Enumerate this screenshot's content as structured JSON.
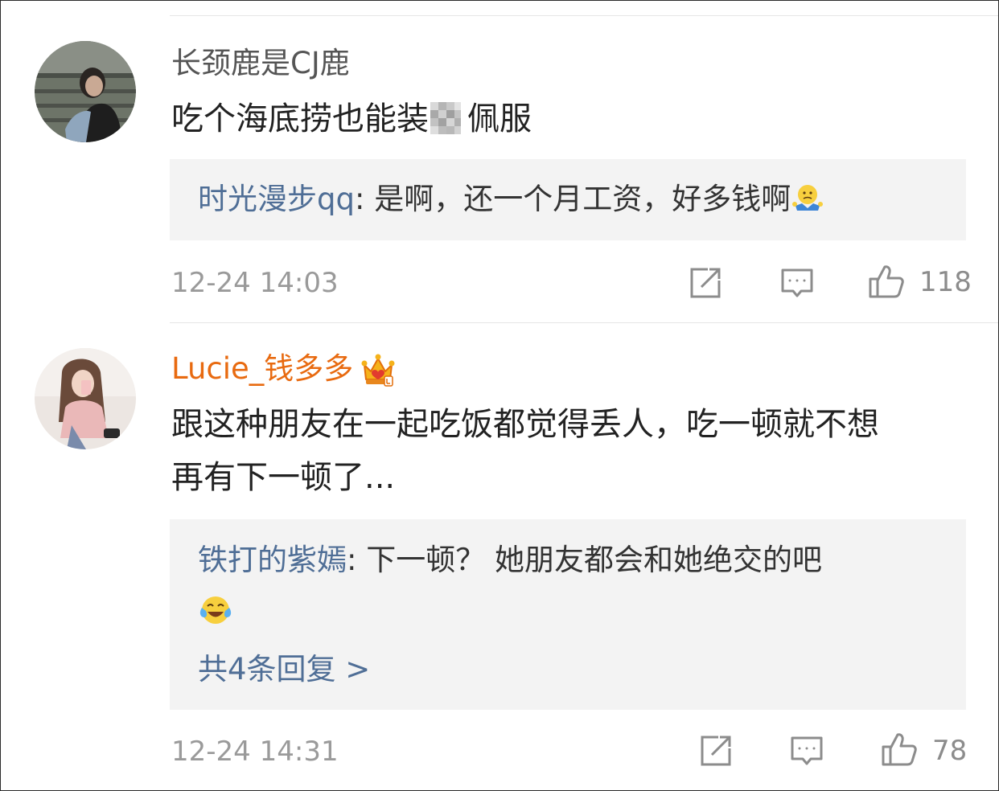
{
  "comments": [
    {
      "username": "长颈鹿是CJ鹿",
      "vip": false,
      "text_before_mosaic": "吃个海底捞也能装",
      "text_after_mosaic": "佩服",
      "reply": {
        "name": "时光漫步qq",
        "separator": ": ",
        "text": "是啊，还一个月工资，好多钱啊",
        "emoji": "shrug-emoji"
      },
      "time": "12-24 14:03",
      "likes": "118"
    },
    {
      "username": "Lucie_钱多多",
      "vip": true,
      "badge": "crown-vip-icon",
      "text_line1": "跟这种朋友在一起吃饭都觉得丢人，吃一顿就不想",
      "text_line2": "再有下一顿了...",
      "reply": {
        "name": "铁打的紫嫣",
        "separator": ": ",
        "text": "下一顿？ 她朋友都会和她绝交的吧",
        "emoji": "laugh-cry-emoji"
      },
      "more_replies": "共4条回复 >",
      "time": "12-24 14:31",
      "likes": "78"
    }
  ],
  "icons": [
    "share-icon",
    "comment-icon",
    "like-icon"
  ],
  "colors": {
    "link_blue": "#4f6e96",
    "vip_orange": "#e86a10",
    "reply_bg": "#f3f3f3",
    "meta_gray": "#9a9a9a"
  }
}
